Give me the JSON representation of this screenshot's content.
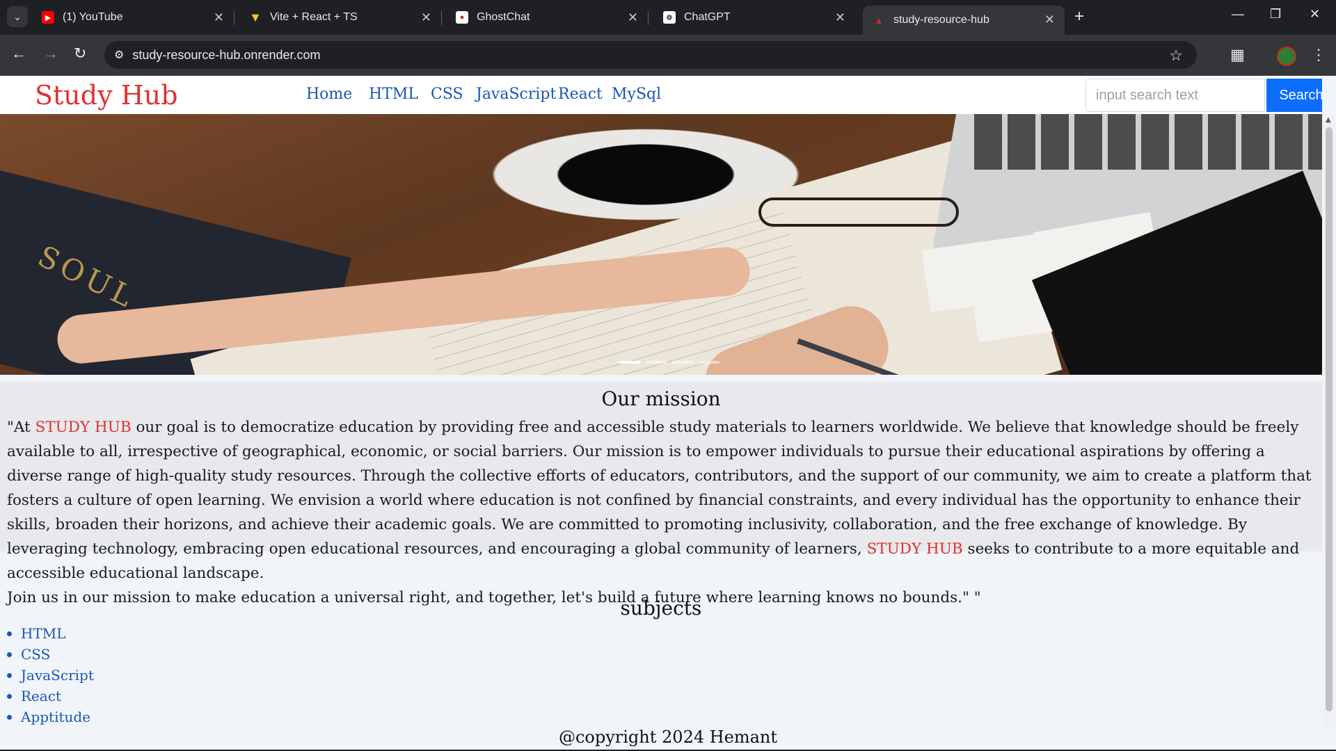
{
  "browser": {
    "tabs": [
      {
        "title": "(1) YouTube",
        "icon": "youtube-icon",
        "active": false
      },
      {
        "title": "Vite + React + TS",
        "icon": "vite-icon",
        "active": false
      },
      {
        "title": "GhostChat",
        "icon": "ghostchat-icon",
        "active": false
      },
      {
        "title": "ChatGPT",
        "icon": "chatgpt-icon",
        "active": false
      },
      {
        "title": "study-resource-hub",
        "icon": "site-favicon-icon",
        "active": true
      }
    ],
    "url": "study-resource-hub.onrender.com"
  },
  "navbar": {
    "brand": "Study Hub",
    "links": [
      "Home",
      "HTML",
      "CSS",
      "JavaScript",
      "React",
      "MySql"
    ],
    "search_placeholder": "input search text",
    "search_button": "Search"
  },
  "carousel": {
    "slide_count": 4,
    "active_index": 0,
    "book_text": "SOUL"
  },
  "mission": {
    "heading": "Our mission",
    "brand_highlight": "STUDY HUB",
    "p1_prefix": "\"At ",
    "p1_middle": " our goal is to democratize education by providing free and accessible study materials to learners worldwide. We believe that knowledge should be freely available to all, irrespective of geographical, economic, or social barriers. Our mission is to empower individuals to pursue their educational aspirations by offering a diverse range of high-quality study resources. Through the collective efforts of educators, contributors, and the support of our community, we aim to create a platform that fosters a culture of open learning. We envision a world where education is not confined by financial constraints, and every individual has the opportunity to enhance their skills, broaden their horizons, and achieve their academic goals. We are committed to promoting inclusivity, collaboration, and the free exchange of knowledge. By leveraging technology, embracing open educational resources, and encouraging a global community of learners, ",
    "p1_suffix": " seeks to contribute to a more equitable and accessible educational landscape.",
    "p2": "Join us in our mission to make education a universal right, and together, let's build a future where learning knows no bounds.\" \""
  },
  "subjects": {
    "heading": "subjects",
    "items": [
      "HTML",
      "CSS",
      "JavaScript",
      "React",
      "Apptitude"
    ]
  },
  "footer": {
    "text": "@copyright 2024 Hemant"
  },
  "colors": {
    "brand_red": "#e03131",
    "link_blue": "#1a56b8",
    "search_blue": "#0d6efd"
  }
}
